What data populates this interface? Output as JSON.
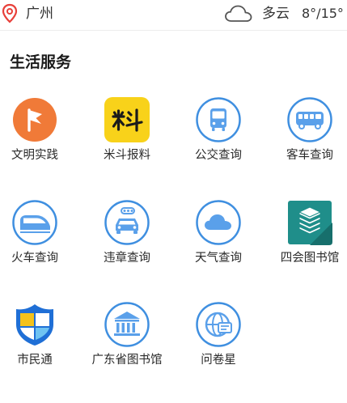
{
  "header": {
    "city": "广州",
    "weather_condition": "多云",
    "temperature": "8°/15°",
    "icons": {
      "location": "location-pin-icon",
      "weather": "cloud-icon"
    }
  },
  "section": {
    "title": "生活服务"
  },
  "services": [
    {
      "label": "文明实践",
      "icon": "flag-icon"
    },
    {
      "label": "米斗报料",
      "icon": "midou-logo-icon"
    },
    {
      "label": "公交查询",
      "icon": "bus-icon"
    },
    {
      "label": "客车查询",
      "icon": "coach-icon"
    },
    {
      "label": "火车查询",
      "icon": "train-icon"
    },
    {
      "label": "违章查询",
      "icon": "car-violation-icon"
    },
    {
      "label": "天气查询",
      "icon": "cloud-icon"
    },
    {
      "label": "四会图书馆",
      "icon": "books-icon"
    },
    {
      "label": "市民通",
      "icon": "shield-icon"
    },
    {
      "label": "广东省图书馆",
      "icon": "library-building-icon"
    },
    {
      "label": "问卷星",
      "icon": "globe-survey-icon"
    }
  ],
  "colors": {
    "accent_blue": "#3f8fe0",
    "icon_light_blue": "#dcecfb",
    "location_red": "#e8403a",
    "orange": "#f07a38",
    "yellow": "#f8d21a",
    "teal": "#1f8e8a"
  }
}
